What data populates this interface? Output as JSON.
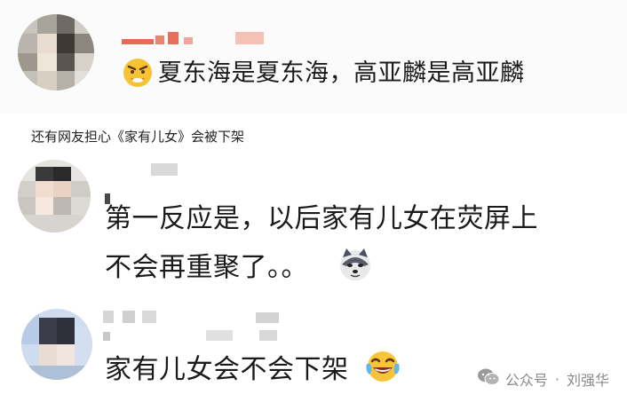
{
  "comments": [
    {
      "text": "夏东海是夏东海，高亚麟是高亚麟"
    },
    {
      "line1": "第一反应是，以后家有儿女在荧屏上",
      "line2": "不会再重聚了。。"
    },
    {
      "text": "家有儿女会不会下架"
    }
  ],
  "caption": "还有网友担心《家有儿女》会被下架",
  "watermark": {
    "prefix": "公众号",
    "separator": "·",
    "name": "刘强华"
  },
  "icons": {
    "emoji1": "angry-face-icon",
    "emoji2": "doge-icon",
    "emoji3": "crying-laughing-icon",
    "watermark": "wechat-icon"
  },
  "colors": {
    "text": "#1a1a1a",
    "watermark": "#8a8a8a",
    "mosaic_red": "#e0503a"
  }
}
